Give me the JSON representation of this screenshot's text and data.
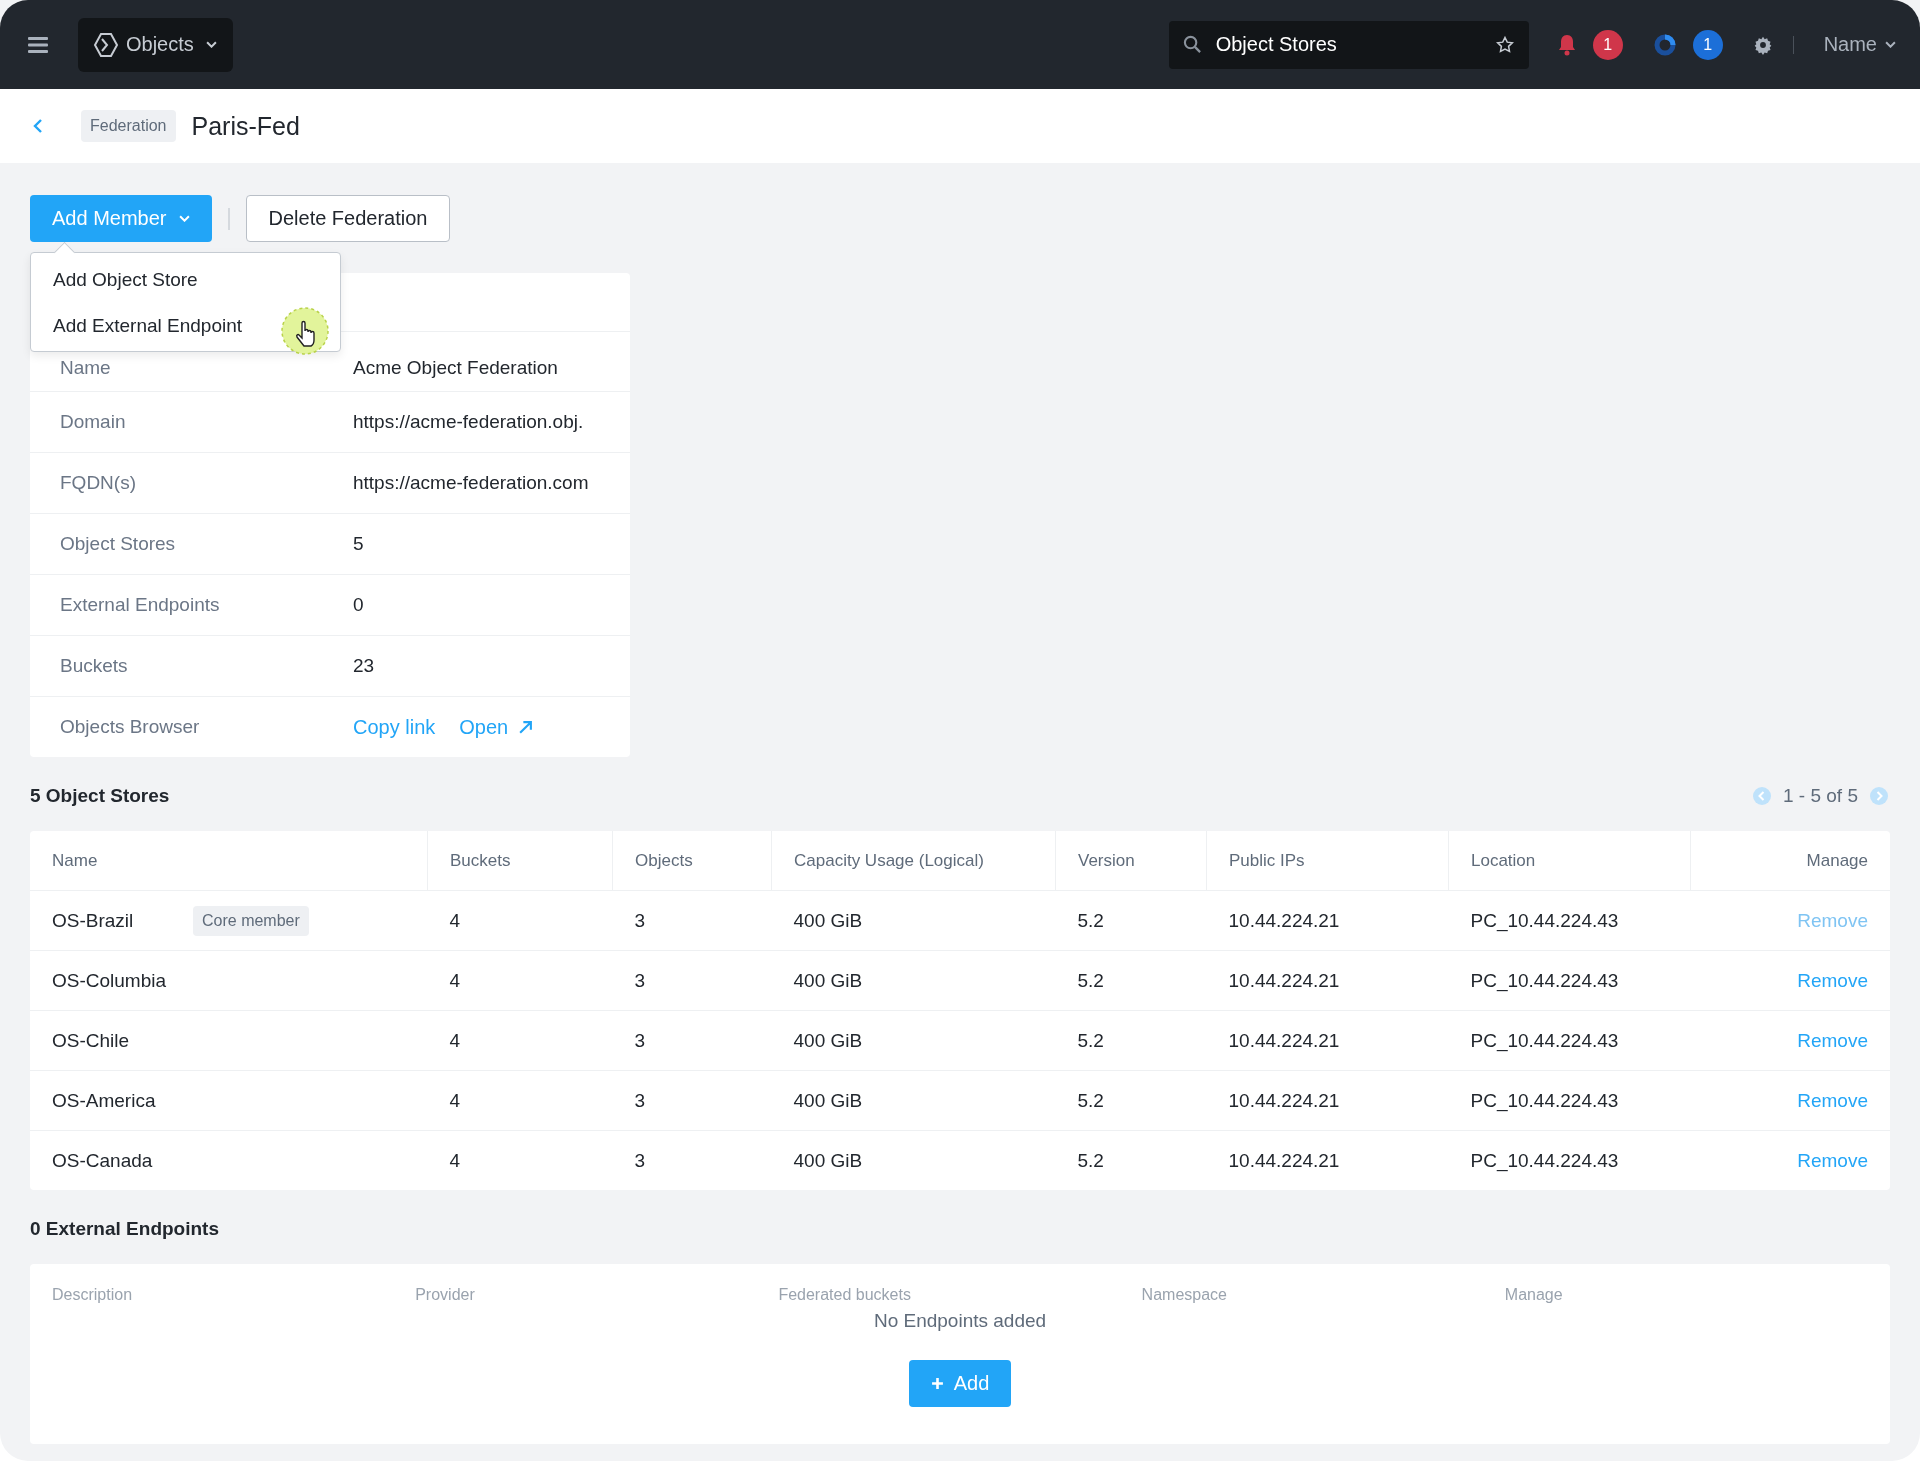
{
  "topbar": {
    "app": "Objects",
    "search": {
      "value": "Object Stores"
    },
    "alerts": "1",
    "tasks": "1",
    "user": "Name"
  },
  "breadcrumb": {
    "tag": "Federation",
    "title": "Paris-Fed"
  },
  "actions": {
    "primary": "Add Member",
    "secondary": "Delete Federation"
  },
  "dropdown": {
    "items": [
      {
        "label": "Add Object Store",
        "selected": false
      },
      {
        "label": "Add External Endpoint",
        "selected": true
      }
    ]
  },
  "details": [
    {
      "label": "Name",
      "value": "Acme Object Federation",
      "kind": "text"
    },
    {
      "label": "Domain",
      "value": "https://acme-federation.obj.",
      "kind": "text"
    },
    {
      "label": "FQDN(s)",
      "value": "https://acme-federation.com",
      "kind": "text"
    },
    {
      "label": "Object Stores",
      "value": "5",
      "kind": "text"
    },
    {
      "label": "External Endpoints",
      "value": "0",
      "kind": "text"
    },
    {
      "label": "Buckets",
      "value": "23",
      "kind": "text"
    },
    {
      "label": "Objects Browser",
      "links": [
        "Copy link",
        "Open"
      ],
      "kind": "links"
    }
  ],
  "stores": {
    "title": "5 Object Stores",
    "pagination": "1 - 5 of 5",
    "columns": [
      "Name",
      "Buckets",
      "Objects",
      "Capacity Usage (Logical)",
      "Version",
      "Public IPs",
      "Location",
      "Manage"
    ],
    "rows": [
      {
        "tag": "Core member",
        "cells": [
          "OS-Brazil",
          "4",
          "3",
          "400 GiB",
          "5.2",
          "10.44.224.21",
          "PC_10.44.224.43"
        ],
        "action": "Remove",
        "disabled": true
      },
      {
        "cells": [
          "OS-Columbia",
          "4",
          "3",
          "400 GiB",
          "5.2",
          "10.44.224.21",
          "PC_10.44.224.43"
        ],
        "action": "Remove",
        "disabled": false
      },
      {
        "cells": [
          "OS-Chile",
          "4",
          "3",
          "400 GiB",
          "5.2",
          "10.44.224.21",
          "PC_10.44.224.43"
        ],
        "action": "Remove",
        "disabled": false
      },
      {
        "cells": [
          "OS-America",
          "4",
          "3",
          "400 GiB",
          "5.2",
          "10.44.224.21",
          "PC_10.44.224.43"
        ],
        "action": "Remove",
        "disabled": false
      },
      {
        "cells": [
          "OS-Canada",
          "4",
          "3",
          "400 GiB",
          "5.2",
          "10.44.224.21",
          "PC_10.44.224.43"
        ],
        "action": "Remove",
        "disabled": false
      }
    ]
  },
  "endpoints": {
    "title": "0 External Endpoints",
    "columns": [
      "Description",
      "Provider",
      "Federated buckets",
      "Namespace",
      "Manage"
    ],
    "empty": "No Endpoints added",
    "add": "Add"
  }
}
